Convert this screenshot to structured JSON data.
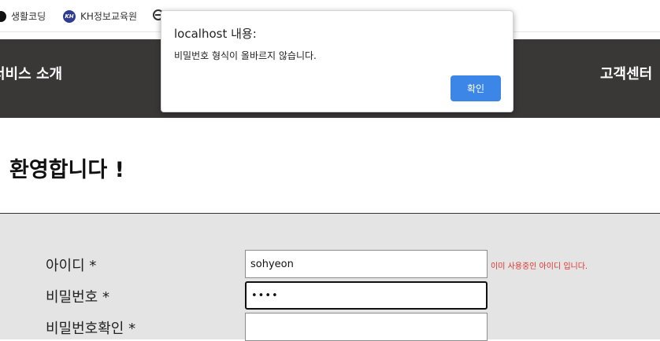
{
  "bookmarks": [
    {
      "label": "생활코딩",
      "icon": "circle-icon"
    },
    {
      "label": "KH정보교육원",
      "icon": "kh-logo-icon",
      "icon_text": "KH"
    },
    {
      "label": "",
      "icon": "globe-icon"
    }
  ],
  "nav": {
    "left_label": "서비스 소개",
    "right_label": "고객센터",
    "background": "#3a3737"
  },
  "page": {
    "welcome": "환영합니다 !"
  },
  "form": {
    "id_label": "아이디 *",
    "id_value": "sohyeon",
    "id_message": "이미 사용중인 아이디 입니다.",
    "pw_label": "비밀번호 *",
    "pw_value": "••••",
    "pw_confirm_label": "비밀번호확인 *",
    "pw_confirm_value": ""
  },
  "dialog": {
    "title": "localhost 내용:",
    "message": "비밀번호 형식이 올바르지 않습니다.",
    "ok_label": "확인",
    "button_color": "#3b86e6"
  }
}
